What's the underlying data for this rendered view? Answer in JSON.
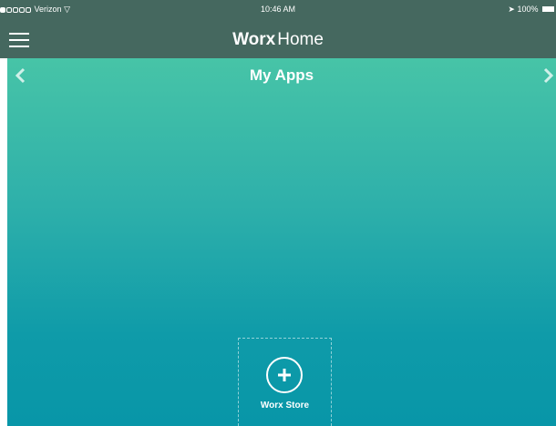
{
  "status_bar": {
    "carrier": "Verizon",
    "time": "10:46 AM",
    "battery": "100%"
  },
  "header": {
    "brand_bold": "Worx",
    "brand_light": "Home"
  },
  "page": {
    "title": "My Apps",
    "prev_glyph": "<",
    "next_glyph": ">"
  },
  "apps": [
    {
      "label": "Worx Store",
      "icon": "plus-circle-icon"
    }
  ],
  "colors": {
    "topbar": "#45685f",
    "gradient_top": "#47c4a7",
    "gradient_bottom": "#0896a8",
    "text": "#ffffff"
  }
}
